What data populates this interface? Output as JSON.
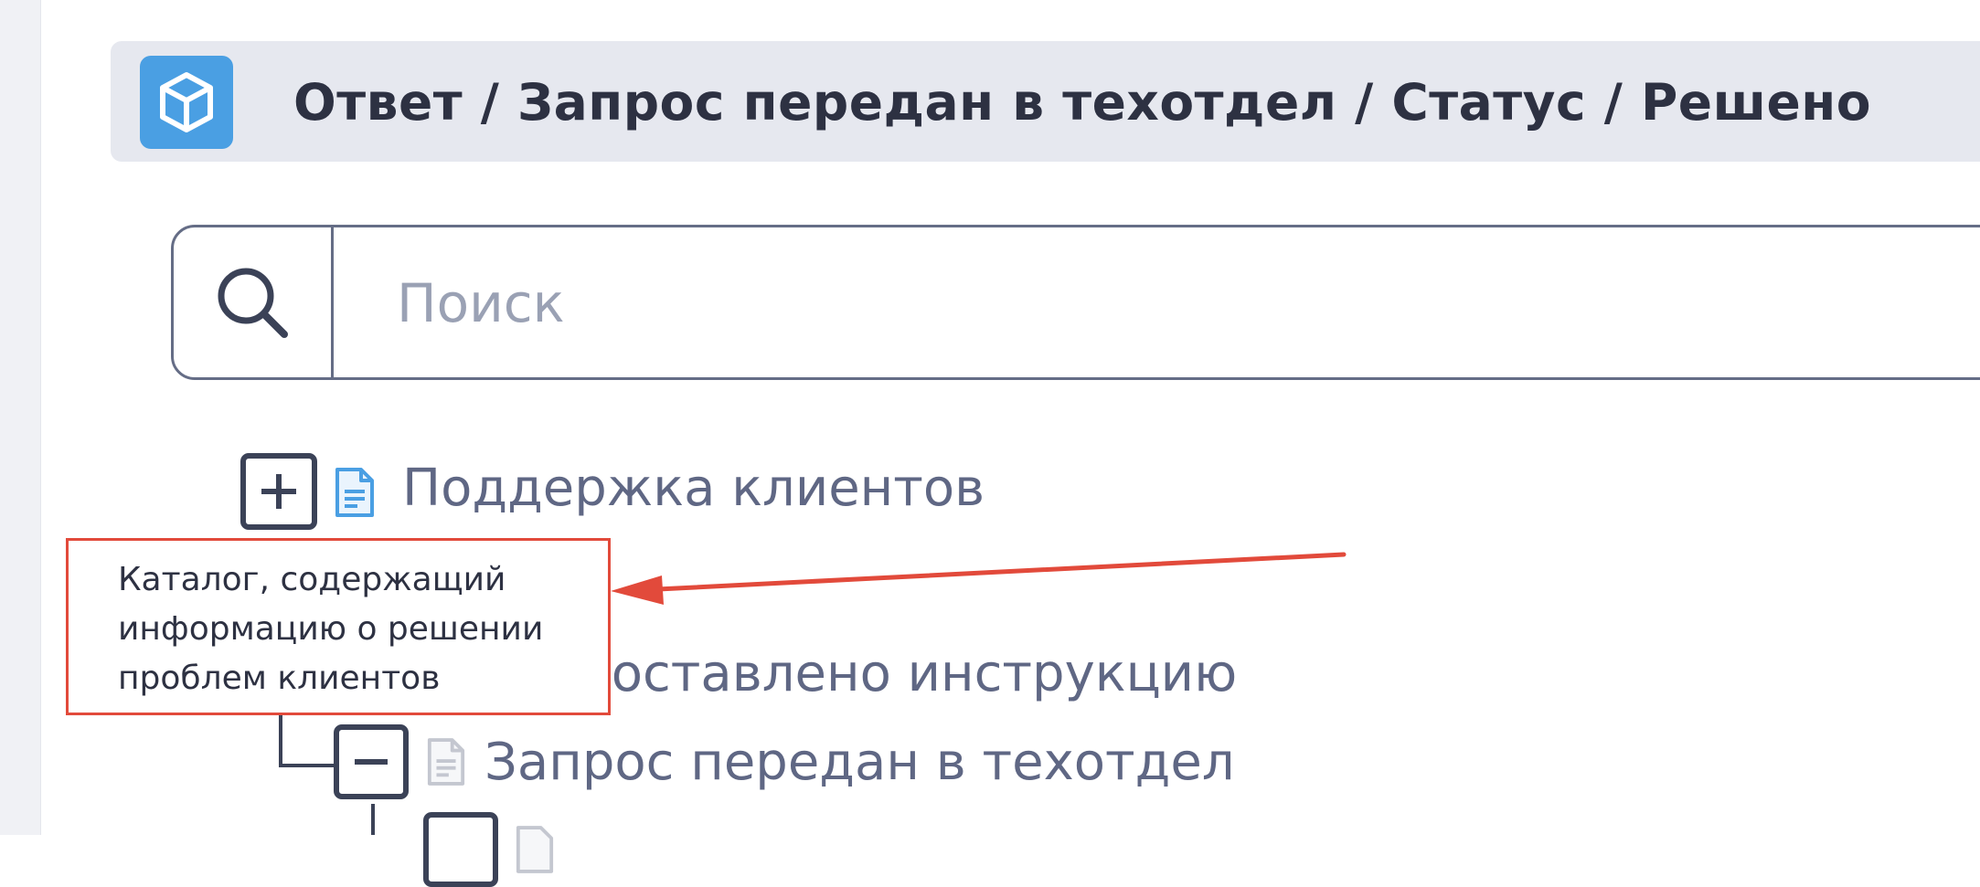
{
  "header": {
    "breadcrumb": "Ответ / Запрос передан в техотдел / Статус / Решено",
    "icon": "cube-icon",
    "accent_color": "#4a9fe3"
  },
  "search": {
    "placeholder": "Поиск",
    "value": "",
    "icon": "search-icon"
  },
  "tree": {
    "items": [
      {
        "label": "Поддержка клиентов",
        "toggle": "expand",
        "icon": "document-icon",
        "icon_color": "#4a9fe3"
      },
      {
        "label": "доставлено инструкцию",
        "toggle": "",
        "icon": "",
        "partially_hidden": true
      },
      {
        "label": "Запрос передан в техотдел",
        "toggle": "collapse",
        "icon": "document-icon",
        "icon_color": "#c4c7d0"
      }
    ]
  },
  "annotation": {
    "lines": [
      "Каталог, содержащий",
      "информацию о решении",
      "проблем клиентов"
    ],
    "border_color": "#e24a3b",
    "arrow_color": "#e24a3b"
  }
}
